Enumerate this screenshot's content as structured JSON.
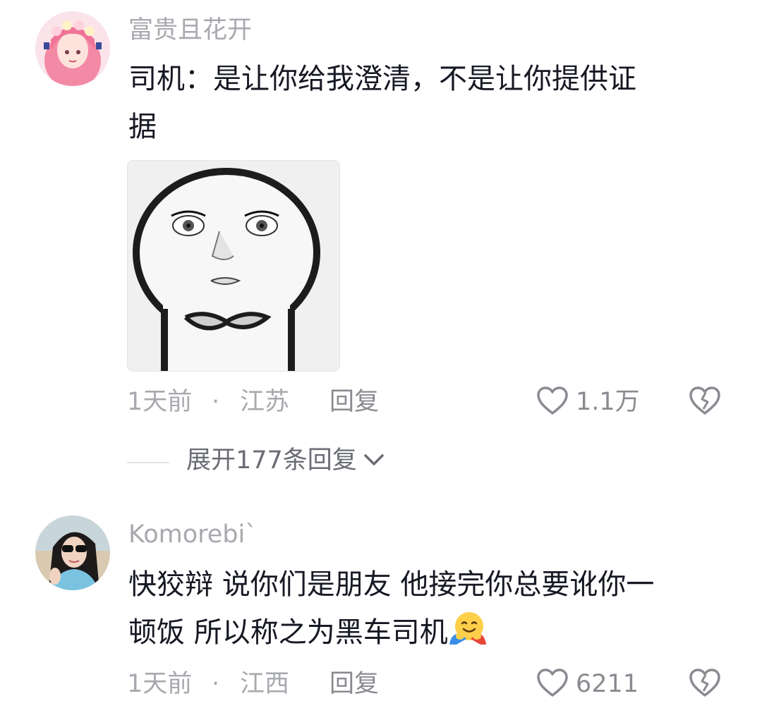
{
  "comments": [
    {
      "username": "富贵且花开",
      "text_line1": "司机：是让你给我澄清，不是让你提供证",
      "text_line2": "据",
      "time": "1天前",
      "separator": "·",
      "location": "江苏",
      "reply_label": "回复",
      "likes": "1.1万"
    },
    {
      "username": "Komorebi`",
      "text_line1": "快狡辩 说你们是朋友 他接完你总要讹你一",
      "text_line2": "顿饭 所以称之为黑车司机",
      "time": "1天前",
      "separator": "·",
      "location": "江西",
      "reply_label": "回复",
      "likes": "6211"
    }
  ],
  "replies": {
    "expand_label": "展开177条回复"
  },
  "icons": {
    "like": "heart-outline-icon",
    "dislike": "broken-heart-icon",
    "expand": "chevron-down-icon",
    "emoji": "hugging-face-emoji"
  },
  "colors": {
    "primary_text": "#161823",
    "secondary_text": "#a7a9ae",
    "action_text": "#8a8b91"
  }
}
